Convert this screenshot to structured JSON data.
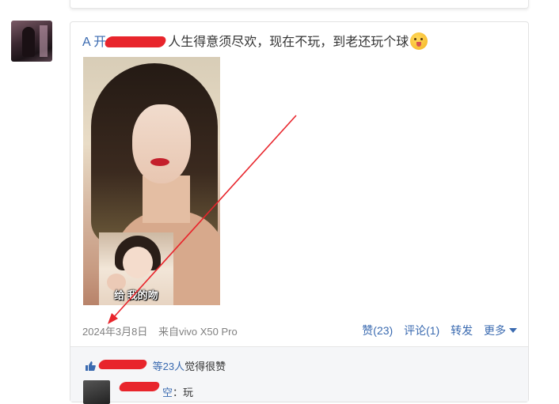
{
  "post": {
    "username": "A 开",
    "text": "人生得意须尽欢，现在不玩，到老还玩个球",
    "emoji": "tongue-emoji",
    "image_caption": "给   我的吻",
    "date": "2024年3月8日",
    "source": "来自vivo X50 Pro"
  },
  "actions": {
    "like": "赞(23)",
    "comment": "评论(1)",
    "repost": "转发",
    "more": "更多"
  },
  "likes": {
    "count_text": "等23人",
    "suffix": "觉得很赞"
  },
  "comment": {
    "user": "空",
    "text": "：玩"
  },
  "colors": {
    "link": "#3a6ab0",
    "meta": "#808080",
    "annotation_arrow": "#e8252c"
  }
}
